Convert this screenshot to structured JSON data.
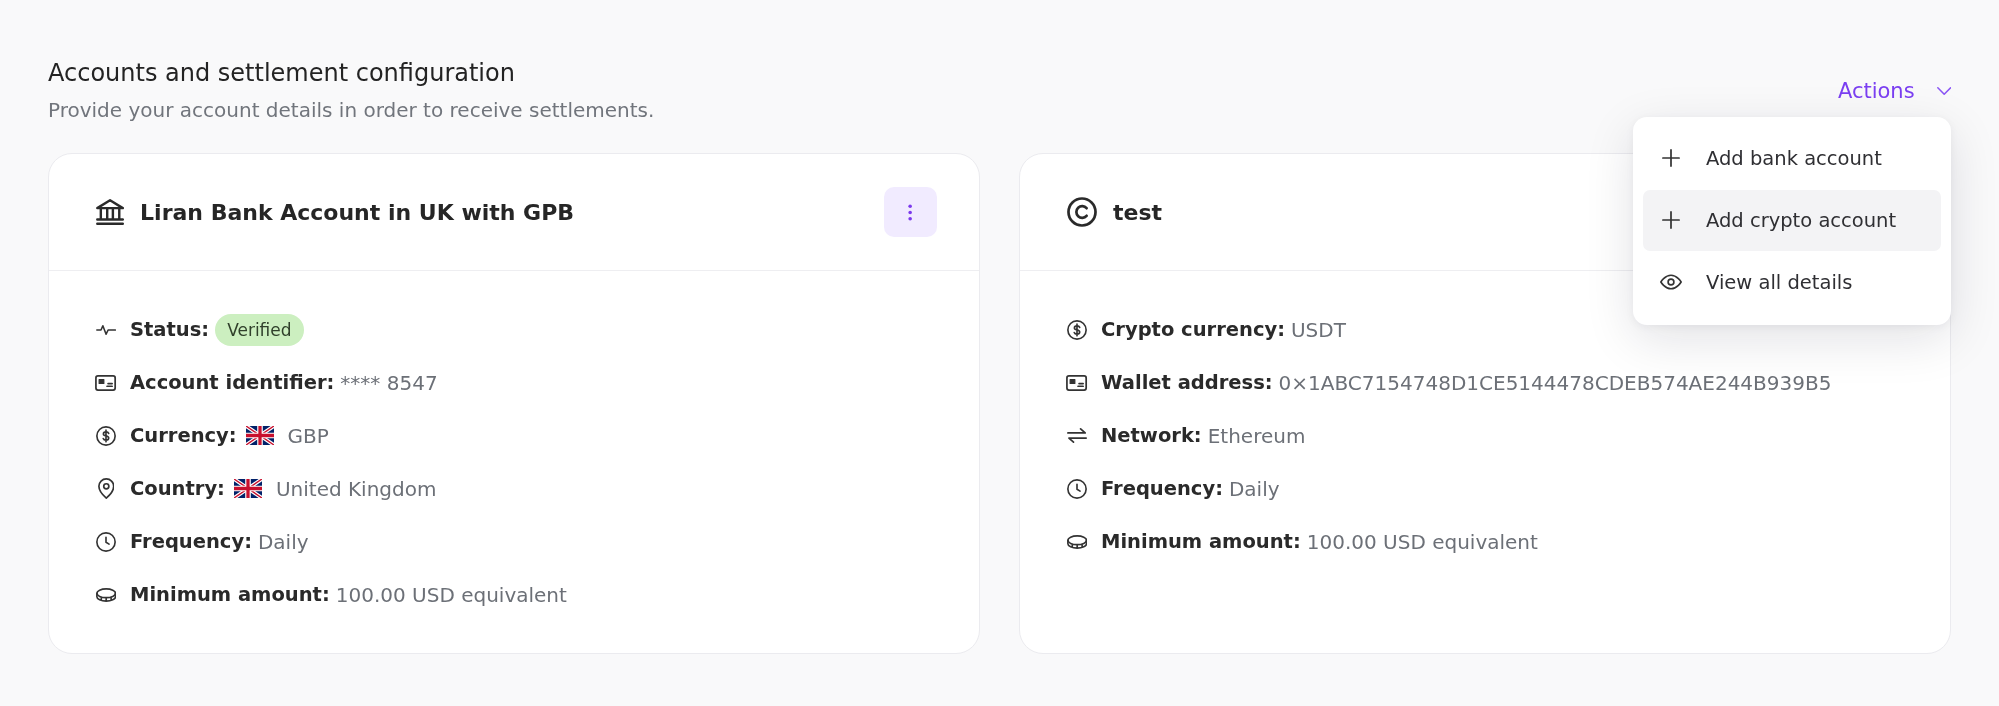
{
  "header": {
    "title": "Accounts and settlement configuration",
    "subtitle": "Provide your account details in order to receive settlements."
  },
  "actions": {
    "label": "Actions",
    "expanded": true,
    "items": [
      {
        "kind": "add",
        "label": "Add bank account",
        "selected": false
      },
      {
        "kind": "add",
        "label": "Add crypto account",
        "selected": true
      },
      {
        "kind": "view",
        "label": "View all details",
        "selected": false
      }
    ]
  },
  "accounts": [
    {
      "kind": "bank",
      "title": "Liran Bank Account in UK with GPB",
      "menu_button": true,
      "fields": [
        {
          "kind": "status",
          "label": "Status:",
          "value": "Verified",
          "flag": false
        },
        {
          "kind": "identifier",
          "label": "Account identifier:",
          "value": "**** 8547",
          "flag": false
        },
        {
          "kind": "currency",
          "label": "Currency:",
          "value": "GBP",
          "flag": true
        },
        {
          "kind": "country",
          "label": "Country:",
          "value": "United Kingdom",
          "flag": true
        },
        {
          "kind": "frequency",
          "label": "Frequency:",
          "value": "Daily",
          "flag": false
        },
        {
          "kind": "amount",
          "label": "Minimum amount:",
          "value": "100.00 USD equivalent",
          "flag": false
        }
      ]
    },
    {
      "kind": "crypto",
      "title": "test",
      "menu_button": false,
      "fields": [
        {
          "kind": "currency",
          "label": "Crypto currency:",
          "value": "USDT",
          "flag": false
        },
        {
          "kind": "wallet",
          "label": "Wallet address:",
          "value": "0×1ABC7154748D1CE5144478CDEB574AE244B939B5",
          "flag": false
        },
        {
          "kind": "network",
          "label": "Network:",
          "value": "Ethereum",
          "flag": false
        },
        {
          "kind": "frequency",
          "label": "Frequency:",
          "value": "Daily",
          "flag": false
        },
        {
          "kind": "amount",
          "label": "Minimum amount:",
          "value": "100.00 USD equivalent",
          "flag": false
        }
      ]
    }
  ]
}
